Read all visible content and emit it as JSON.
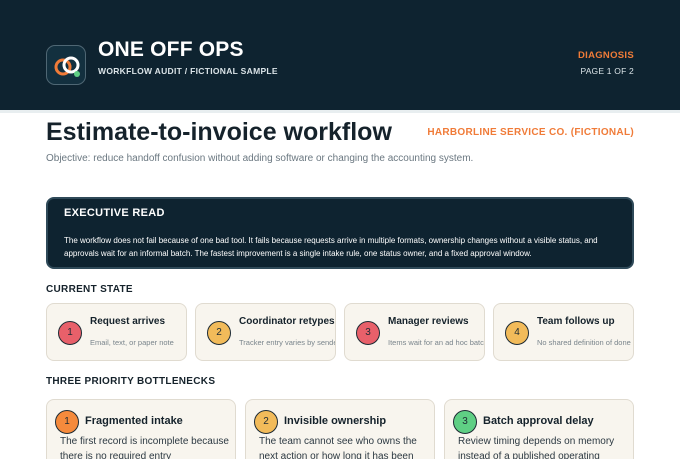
{
  "header": {
    "brand": "ONE OFF OPS",
    "subtitle": "WORKFLOW AUDIT  /  FICTIONAL SAMPLE",
    "tag": "DIAGNOSIS",
    "page": "PAGE 1 OF 2"
  },
  "title": "Estimate-to-invoice workflow",
  "client": "HARBORLINE SERVICE CO. (FICTIONAL)",
  "objective": "Objective: reduce handoff confusion without adding software or changing the accounting system.",
  "executive": {
    "heading": "EXECUTIVE READ",
    "body": "The workflow does not fail because of one bad tool. It fails because requests arrive in multiple formats, ownership changes without a visible status, and approvals wait for an informal batch. The fastest improvement is a single intake rule, one status owner, and a fixed approval window."
  },
  "current_state": {
    "heading": "CURRENT STATE",
    "steps": [
      {
        "num": "1",
        "title": "Request arrives",
        "desc": "Email, text, or paper note",
        "color": "#e8606a"
      },
      {
        "num": "2",
        "title": "Coordinator retypes",
        "desc": "Tracker entry varies by sender",
        "color": "#f2bb5a"
      },
      {
        "num": "3",
        "title": "Manager reviews",
        "desc": "Items wait for an ad hoc batch",
        "color": "#e8606a"
      },
      {
        "num": "4",
        "title": "Team follows up",
        "desc": "No shared definition of done",
        "color": "#f2bb5a"
      }
    ]
  },
  "bottlenecks": {
    "heading": "THREE PRIORITY BOTTLENECKS",
    "items": [
      {
        "num": "1",
        "title": "Fragmented intake",
        "body": "The first record is incomplete because there is no required entry",
        "color": "#f58a3c"
      },
      {
        "num": "2",
        "title": "Invisible ownership",
        "body": "The team cannot see who owns the next action or how long it has been",
        "color": "#f2bb5a"
      },
      {
        "num": "3",
        "title": "Batch approval delay",
        "body": "Review timing depends on memory instead of a published operating",
        "color": "#5fcf84"
      }
    ]
  }
}
